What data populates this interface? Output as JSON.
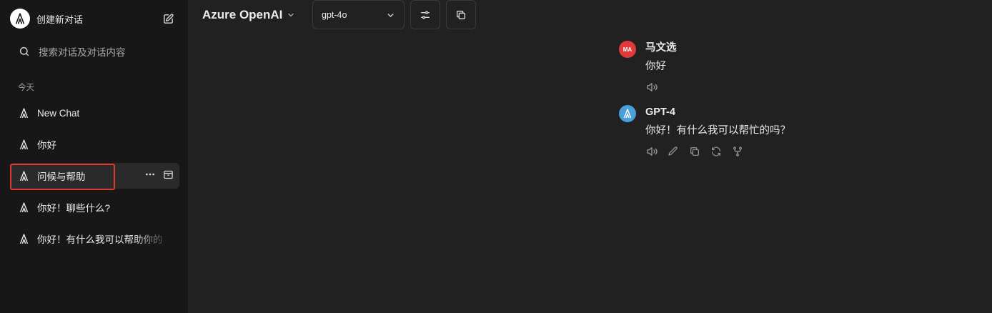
{
  "sidebar": {
    "new_chat_label": "创建新对话",
    "search_placeholder": "搜索对话及对话内容",
    "section_today": "今天",
    "conversations": [
      {
        "label": "New Chat"
      },
      {
        "label": "你好"
      },
      {
        "label": "问候与帮助"
      },
      {
        "label": "你好！聊些什么?"
      },
      {
        "label": "你好！有什么我可以帮助你的"
      }
    ]
  },
  "header": {
    "endpoint_title": "Azure OpenAI",
    "model_selected": "gpt-4o"
  },
  "messages": [
    {
      "avatar_initials": "MA",
      "author": "马文选",
      "text": "你好"
    },
    {
      "author": "GPT-4",
      "text": "你好！有什么我可以帮忙的吗？"
    }
  ],
  "colors": {
    "sidebar_bg": "#171717",
    "main_bg": "#212121",
    "highlight": "#e03a30",
    "user_avatar": "#e03a3a",
    "gpt_avatar": "#4a9fd8"
  }
}
